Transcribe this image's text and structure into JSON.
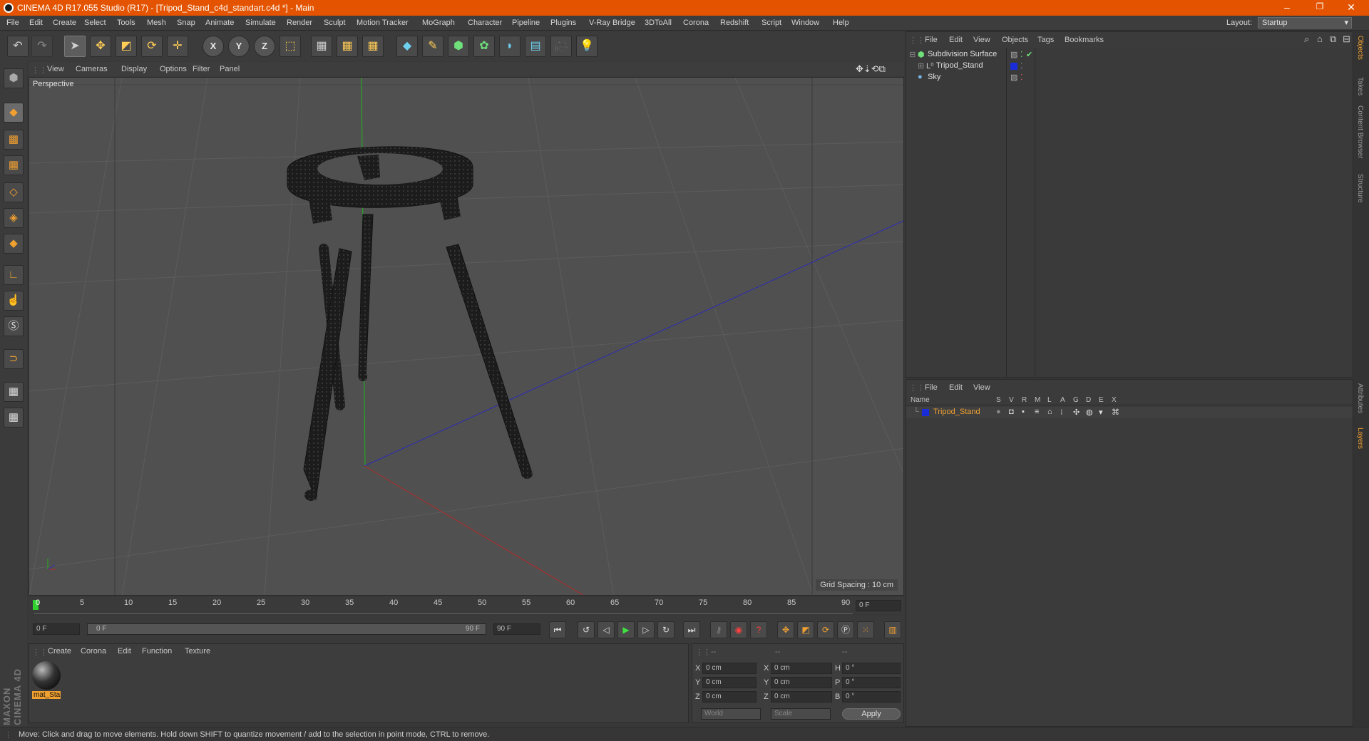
{
  "window": {
    "title": "CINEMA 4D R17.055 Studio (R17) - [Tripod_Stand_c4d_standart.c4d *] - Main",
    "controls": [
      "–",
      "❐",
      "✕"
    ]
  },
  "menubar": {
    "items": [
      "File",
      "Edit",
      "Create",
      "Select",
      "Tools",
      "Mesh",
      "Snap",
      "Animate",
      "Simulate",
      "Render",
      "Sculpt",
      "Motion Tracker",
      "MoGraph",
      "Character",
      "Pipeline",
      "Plugins",
      "V-Ray Bridge",
      "3DToAll",
      "Corona",
      "Redshift",
      "Script",
      "Window",
      "Help"
    ],
    "layout_label": "Layout:",
    "layout_value": "Startup"
  },
  "viewport": {
    "menu": [
      "View",
      "Cameras",
      "Display",
      "Options",
      "Filter",
      "Panel"
    ],
    "label": "Perspective",
    "grid_spacing": "Grid Spacing : 10 cm"
  },
  "timeline": {
    "ticks": [
      "0",
      "5",
      "10",
      "15",
      "20",
      "25",
      "30",
      "35",
      "40",
      "45",
      "50",
      "55",
      "60",
      "65",
      "70",
      "75",
      "80",
      "85",
      "90"
    ],
    "current_frame": "0 F",
    "start_field": "0 F",
    "range_start": "0 F",
    "range_end": "90 F",
    "end_field": "90 F"
  },
  "material_panel": {
    "menu": [
      "Create",
      "Corona",
      "Edit",
      "Function",
      "Texture"
    ],
    "material_name": "mat_Sta"
  },
  "coord_panel": {
    "headers": [
      "--",
      "--",
      "--"
    ],
    "rows": [
      {
        "a": "X",
        "av": "0 cm",
        "b": "X",
        "bv": "0 cm",
        "c": "H",
        "cv": "0 °"
      },
      {
        "a": "Y",
        "av": "0 cm",
        "b": "Y",
        "bv": "0 cm",
        "c": "P",
        "cv": "0 °"
      },
      {
        "a": "Z",
        "av": "0 cm",
        "b": "Z",
        "bv": "0 cm",
        "c": "B",
        "cv": "0 °"
      }
    ],
    "world": "World",
    "scale": "Scale",
    "apply": "Apply"
  },
  "object_manager": {
    "menu": [
      "File",
      "Edit",
      "View",
      "Objects",
      "Tags",
      "Bookmarks"
    ],
    "objects": [
      {
        "name": "Subdivision Surface",
        "icon": "subdivision-icon"
      },
      {
        "name": "Tripod_Stand",
        "icon": "null-icon"
      },
      {
        "name": "Sky",
        "icon": "sky-icon"
      }
    ]
  },
  "layer_manager": {
    "menu": [
      "File",
      "Edit",
      "View"
    ],
    "columns": [
      "Name",
      "S",
      "V",
      "R",
      "M",
      "L",
      "A",
      "G",
      "D",
      "E",
      "X"
    ],
    "layers": [
      {
        "name": "Tripod_Stand",
        "color": "#1a2cd8"
      }
    ]
  },
  "side_tabs": [
    "Objects",
    "Takes",
    "Content Browser",
    "Structure",
    "Attributes",
    "Layers"
  ],
  "status": "Move: Click and drag to move elements. Hold down SHIFT to quantize movement / add to the selection in point mode, CTRL to remove.",
  "brand": "MAXON CINEMA 4D",
  "colors": {
    "accent": "#e45400",
    "highlight": "#f0a030",
    "layer_blue": "#1a2cd8"
  }
}
